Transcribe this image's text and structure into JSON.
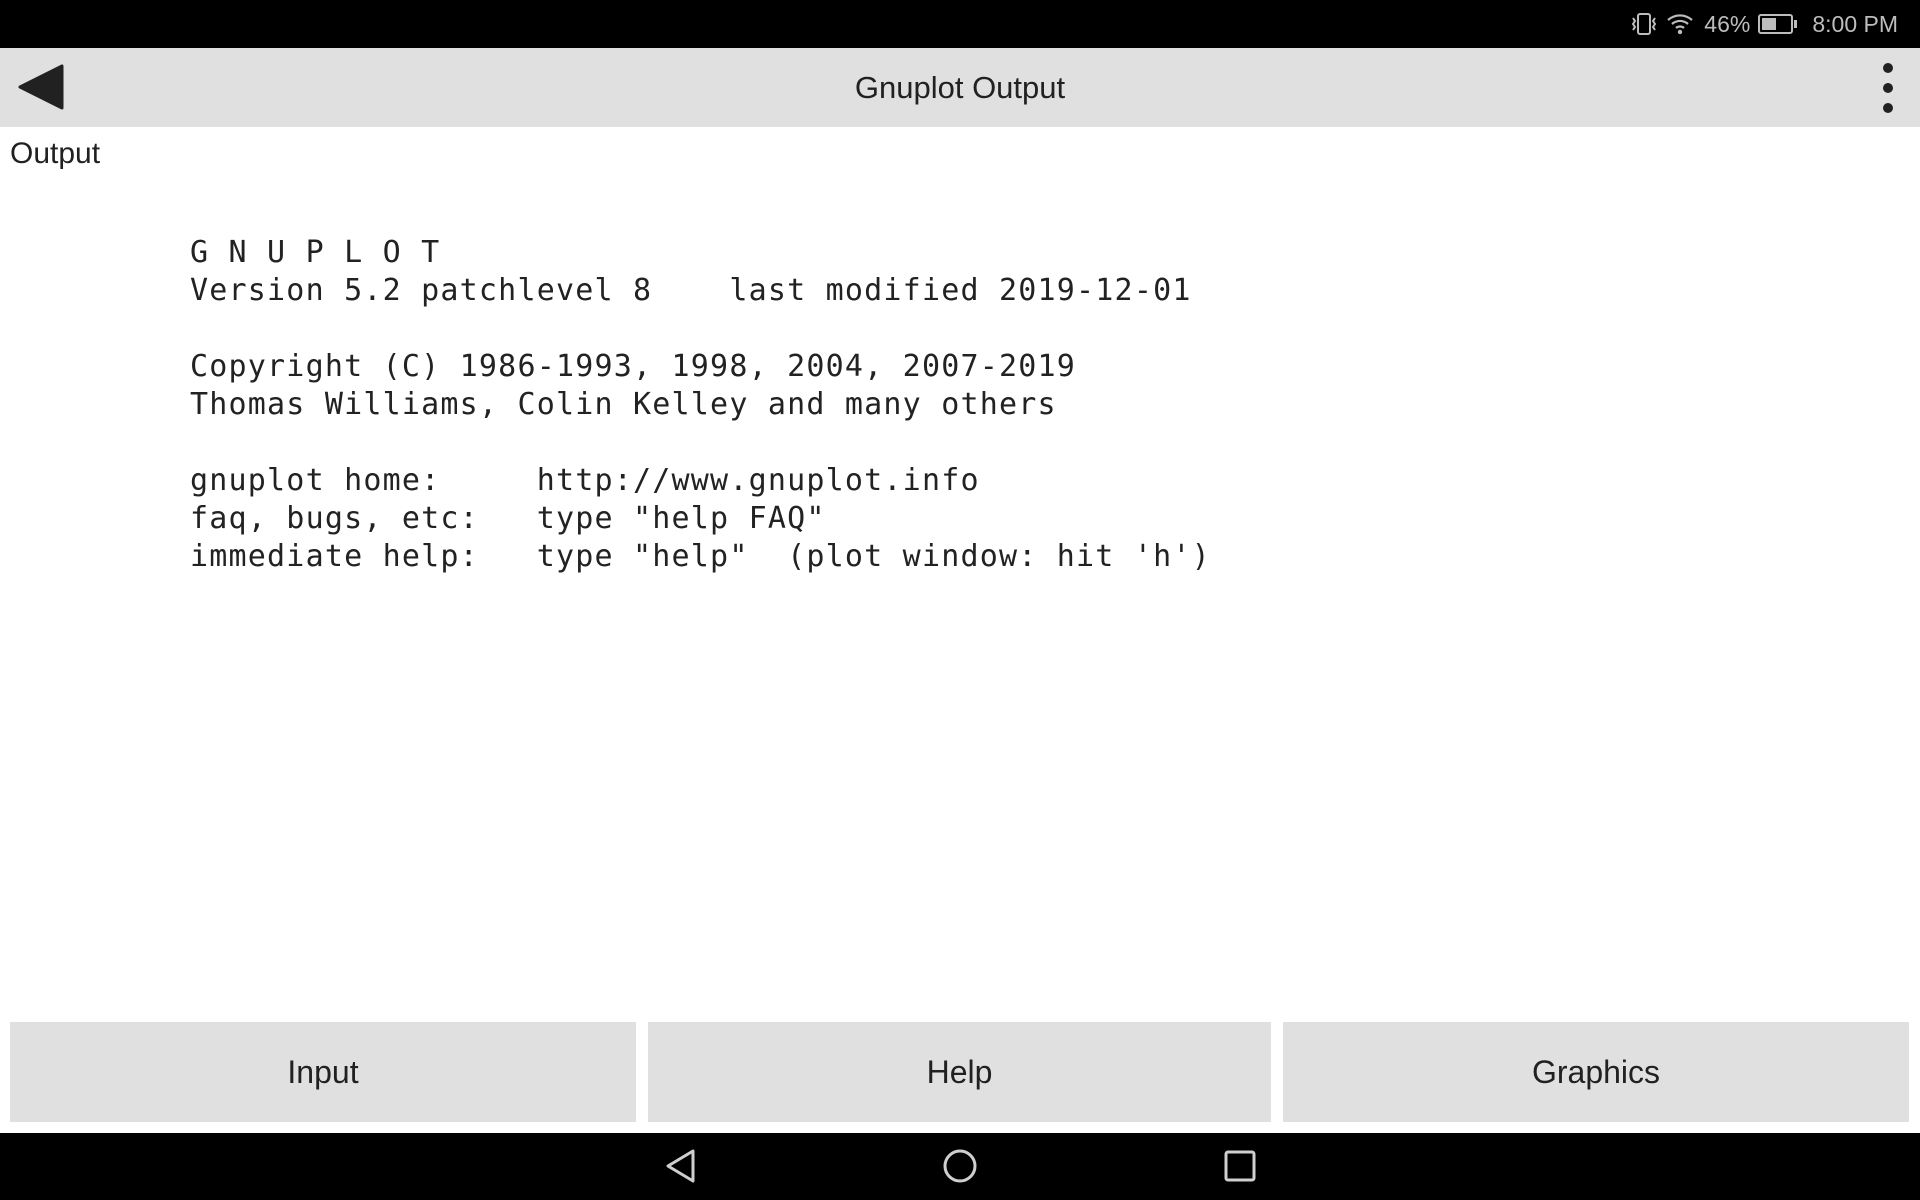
{
  "status_bar": {
    "battery": "46%",
    "time": "8:00 PM",
    "icons": [
      "vibrate-icon",
      "wifi-icon",
      "battery-icon"
    ],
    "battery_level": 0.46
  },
  "toolbar": {
    "title": "Gnuplot Output",
    "back_icon": "back-arrow-icon",
    "menu_icon": "overflow-menu-icon"
  },
  "section_label": "Output",
  "output_lines": [
    "G N U P L O T",
    "Version 5.2 patchlevel 8    last modified 2019-12-01",
    "",
    "Copyright (C) 1986-1993, 1998, 2004, 2007-2019",
    "Thomas Williams, Colin Kelley and many others",
    "",
    "gnuplot home:     http://www.gnuplot.info",
    "faq, bugs, etc:   type \"help FAQ\"",
    "immediate help:   type \"help\"  (plot window: hit 'h')"
  ],
  "buttons": {
    "input": "Input",
    "help": "Help",
    "graphics": "Graphics"
  },
  "nav_bar": {
    "icons": [
      "nav-back-icon",
      "nav-home-icon",
      "nav-recents-icon"
    ]
  }
}
